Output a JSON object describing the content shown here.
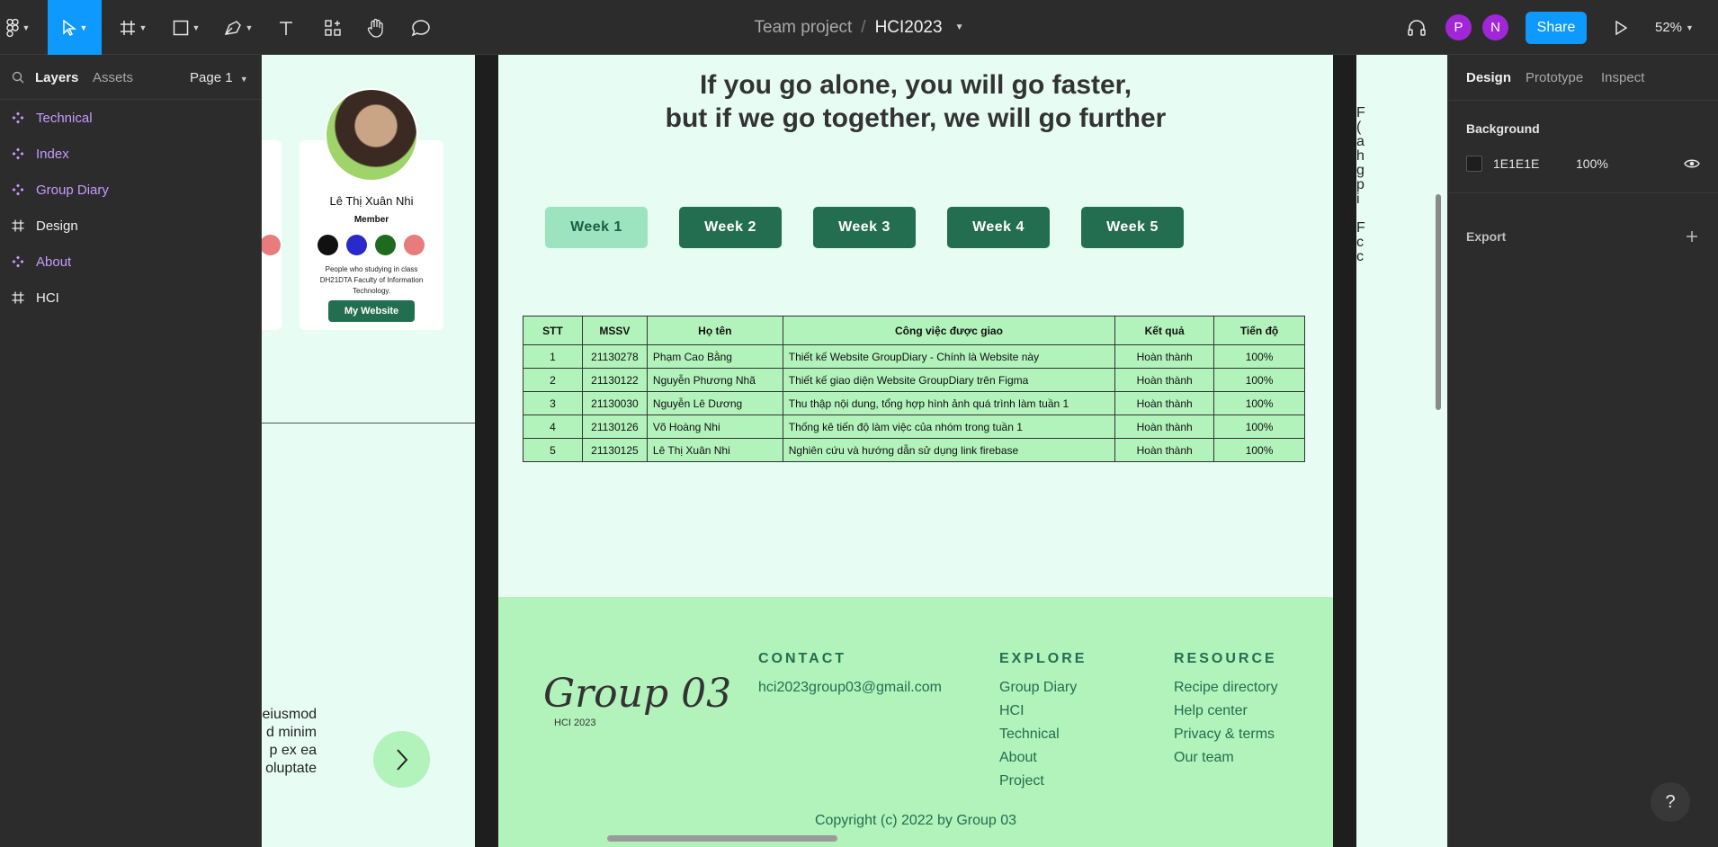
{
  "toolbar": {
    "breadcrumb_team": "Team project",
    "breadcrumb_sep": "/",
    "file_name": "HCI2023",
    "avatars": [
      {
        "initial": "P",
        "color": "#a126d8"
      },
      {
        "initial": "N",
        "color": "#a126d8"
      }
    ],
    "share_label": "Share",
    "zoom": "52%"
  },
  "left_panel": {
    "tab_layers": "Layers",
    "tab_assets": "Assets",
    "page_label": "Page 1",
    "layers": [
      {
        "label": "Technical",
        "type": "component"
      },
      {
        "label": "Index",
        "type": "component"
      },
      {
        "label": "Group Diary",
        "type": "component"
      },
      {
        "label": "Design",
        "type": "frame"
      },
      {
        "label": "About",
        "type": "component"
      },
      {
        "label": "HCI",
        "type": "frame"
      }
    ]
  },
  "frame_about": {
    "member_name": "Lê Thị Xuân Nhi",
    "member_role": "Member",
    "member_desc": "People who studying in class DH21DTA Faculty of Information Technology.",
    "website_btn": "My Website",
    "dot_colors": [
      "#111111",
      "#2a2acb",
      "#1e6a1e",
      "#e87b7b"
    ],
    "lorem_lines": [
      "eiusmod",
      "d minim",
      "p ex ea",
      "oluptate"
    ]
  },
  "frame_main": {
    "quote_line1": "If you go alone, you will go faster,",
    "quote_line2": "but if we go together, we will go further",
    "weeks": [
      "Week 1",
      "Week 2",
      "Week 3",
      "Week 4",
      "Week 5"
    ],
    "table": {
      "headers": [
        "STT",
        "MSSV",
        "Họ tên",
        "Công việc được giao",
        "Kết quả",
        "Tiến độ"
      ],
      "rows": [
        [
          "1",
          "21130278",
          "Phạm Cao Bằng",
          "Thiết kế Website GroupDiary - Chính là Website này",
          "Hoàn thành",
          "100%"
        ],
        [
          "2",
          "21130122",
          "Nguyễn Phương Nhã",
          "Thiết kế giao diện Website GroupDiary trên Figma",
          "Hoàn thành",
          "100%"
        ],
        [
          "3",
          "21130030",
          "Nguyễn Lê Dương",
          "Thu thập nội dung, tổng hợp hình ảnh quá trình làm tuần 1",
          "Hoàn thành",
          "100%"
        ],
        [
          "4",
          "21130126",
          "Võ Hoàng Nhi",
          "Thống kê tiến độ làm việc của nhóm trong tuần 1",
          "Hoàn thành",
          "100%"
        ],
        [
          "5",
          "21130125",
          "Lê Thị Xuân Nhi",
          "Nghiên cứu và hướng dẫn sử dụng link firebase",
          "Hoàn thành",
          "100%"
        ]
      ]
    },
    "footer": {
      "brand": "Group 03",
      "brand_sub": "HCI 2023",
      "contact_title": "CONTACT",
      "contact_email": "hci2023group03@gmail.com",
      "explore_title": "EXPLORE",
      "explore_links": [
        "Group Diary",
        "HCI",
        "Technical",
        "About",
        "Project"
      ],
      "resource_title": "RESOURCE",
      "resource_links": [
        "Recipe directory",
        "Help center",
        "Privacy & terms",
        "Our team"
      ],
      "copyright": "Copyright (c) 2022 by Group 03"
    }
  },
  "frame_right_fragments": [
    "F",
    "(",
    "a",
    "h",
    "g",
    "p",
    "i",
    "",
    "F",
    "c",
    "c"
  ],
  "right_panel": {
    "tab_design": "Design",
    "tab_prototype": "Prototype",
    "tab_inspect": "Inspect",
    "background_label": "Background",
    "bg_hex": "1E1E1E",
    "bg_opacity": "100%",
    "export_label": "Export"
  },
  "help_label": "?"
}
